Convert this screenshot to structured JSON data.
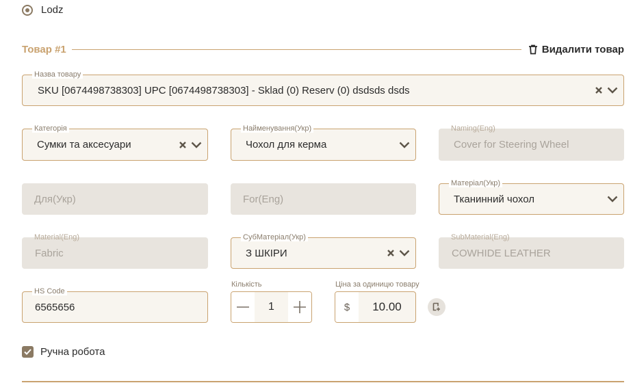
{
  "location": {
    "label": "Lodz",
    "selected": true
  },
  "item": {
    "title": "Товар #1",
    "delete_label": "Видалити товар",
    "name": {
      "label": "Назва товару",
      "value": "SKU [0674498738303] UPC [0674498738303] - Sklad (0) Reserv (0) dsdsds dsds"
    },
    "category": {
      "label": "Категорія",
      "value": "Сумки та аксесуари"
    },
    "name_ukr": {
      "label": "Найменування(Укр)",
      "value": "Чохол для керма"
    },
    "naming_eng": {
      "label": "Naming(Eng)",
      "value": "Cover for Steering Wheel"
    },
    "for_ukr": {
      "placeholder": "Для(Укр)"
    },
    "for_eng": {
      "placeholder": "For(Eng)"
    },
    "material_ukr": {
      "label": "Матеріал(Укр)",
      "value": "Тканинний чохол"
    },
    "material_eng": {
      "label": "Material(Eng)",
      "value": "Fabric"
    },
    "submaterial_ukr": {
      "label": "СубМатеріал(Укр)",
      "value": "З ШКІРИ"
    },
    "submaterial_eng": {
      "label": "SubMaterial(Eng)",
      "value": "COWHIDE LEATHER"
    },
    "hs_code": {
      "label": "HS Code",
      "value": "6565656"
    },
    "quantity": {
      "label": "Кількість",
      "value": "1"
    },
    "unit_price": {
      "label": "Ціна за одиницю товару",
      "currency": "$",
      "value": "10.00"
    },
    "handmade": {
      "label": "Ручна робота",
      "checked": true
    }
  },
  "icons": {
    "trash": "trash-icon",
    "clear": "clear-icon",
    "chevron": "chevron-down-icon",
    "minus": "minus-icon",
    "plus": "plus-icon",
    "copy": "copy-icon",
    "check": "check-icon"
  },
  "colors": {
    "accent": "#c9a26f",
    "field_bg": "#f8f5ef",
    "disabled_bg": "#e8e4de",
    "checkbox": "#8b7a63"
  }
}
